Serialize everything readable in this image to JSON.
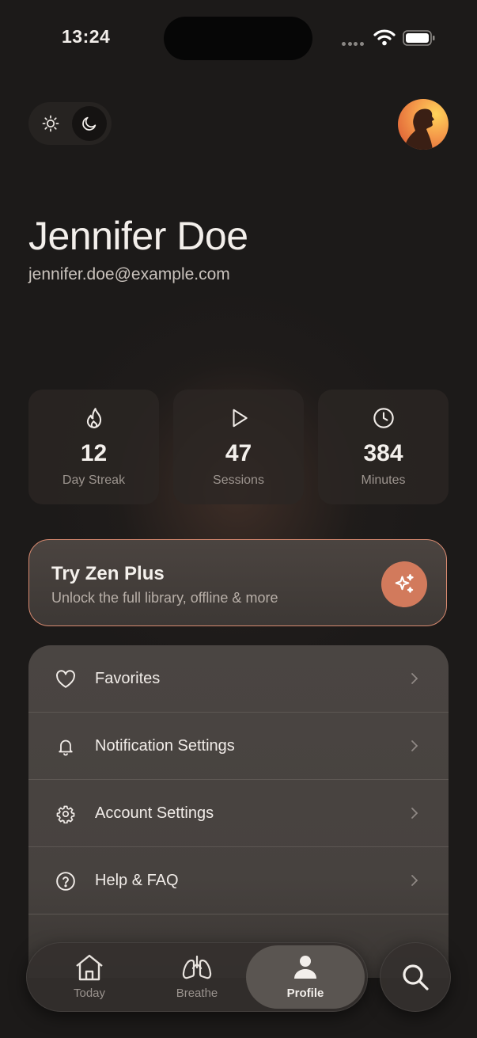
{
  "status_bar": {
    "time": "13:24"
  },
  "theme_toggle": {
    "options": [
      "light",
      "dark"
    ],
    "selected": "dark"
  },
  "profile": {
    "name": "Jennifer Doe",
    "email": "jennifer.doe@example.com"
  },
  "stats": [
    {
      "icon": "flame-icon",
      "value": "12",
      "label": "Day Streak"
    },
    {
      "icon": "play-icon",
      "value": "47",
      "label": "Sessions"
    },
    {
      "icon": "clock-icon",
      "value": "384",
      "label": "Minutes"
    }
  ],
  "promo": {
    "title": "Try Zen Plus",
    "subtitle": "Unlock the full library, offline & more",
    "icon": "sparkles-icon"
  },
  "menu": [
    {
      "icon": "heart-icon",
      "label": "Favorites"
    },
    {
      "icon": "bell-icon",
      "label": "Notification Settings"
    },
    {
      "icon": "gear-icon",
      "label": "Account Settings"
    },
    {
      "icon": "help-circle-icon",
      "label": "Help & FAQ"
    }
  ],
  "tab_bar": {
    "tabs": [
      {
        "icon": "home-icon",
        "label": "Today"
      },
      {
        "icon": "lungs-icon",
        "label": "Breathe"
      },
      {
        "icon": "person-icon",
        "label": "Profile"
      }
    ],
    "active": "Profile",
    "search_icon": "search-icon"
  },
  "colors": {
    "background": "#1c1a19",
    "accent": "#d27a5c",
    "promo_border": "#d88a70",
    "card": "#2c2724",
    "menu": "#4a4542"
  }
}
